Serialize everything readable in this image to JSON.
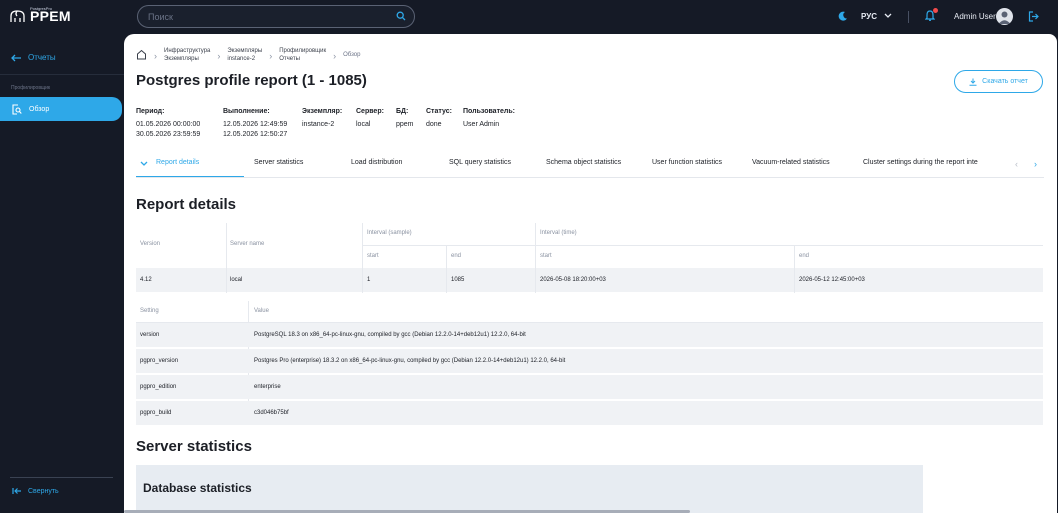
{
  "app": {
    "brand": "PPEM",
    "brand_sub": "PostgresPro",
    "search_placeholder": "Поиск",
    "lang": "РУС",
    "user": "Admin User"
  },
  "sidebar": {
    "back_label": "Отчеты",
    "group_label": "Профилировщик",
    "active_item": "Обзор",
    "collapse_label": "Свернуть"
  },
  "breadcrumbs": [
    {
      "line1": "Инфраструктура",
      "line2": "Экземпляры"
    },
    {
      "line1": "Экземпляры",
      "line2": "instance-2"
    },
    {
      "line1": "Профилировщик",
      "line2": "Отчеты"
    },
    {
      "line1": "Обзор",
      "line2": ""
    }
  ],
  "page": {
    "title": "Postgres profile report (1 - 1085)",
    "download_label": "Скачать отчет"
  },
  "meta": {
    "period": {
      "label": "Период:",
      "line1": "01.05.2026 00:00:00",
      "line2": "30.05.2026 23:59:59"
    },
    "execution": {
      "label": "Выполнение:",
      "line1": "12.05.2026 12:49:59",
      "line2": "12.05.2026 12:50:27"
    },
    "instance": {
      "label": "Экземпляр:",
      "value": "instance-2"
    },
    "server": {
      "label": "Сервер:",
      "value": "local"
    },
    "db": {
      "label": "БД:",
      "value": "ppem"
    },
    "status": {
      "label": "Статус:",
      "value": "done"
    },
    "user": {
      "label": "Пользователь:",
      "value": "User Admin"
    }
  },
  "tabs": [
    "Report details",
    "Server statistics",
    "Load distribution",
    "SQL query statistics",
    "Schema object statistics",
    "User function statistics",
    "Vacuum-related statistics",
    "Cluster settings during the report inte"
  ],
  "report_details": {
    "heading": "Report details",
    "headers": {
      "version": "Version",
      "server_name": "Server name",
      "interval_sample": "Interval (sample)",
      "interval_time": "Interval (time)",
      "start": "start",
      "end": "end"
    },
    "row": {
      "version": "4.12",
      "server_name": "local",
      "sample_start": "1",
      "sample_end": "1085",
      "time_start": "2026-05-08 18:20:00+03",
      "time_end": "2026-05-12 12:45:00+03"
    }
  },
  "settings": {
    "headers": {
      "setting": "Setting",
      "value": "Value"
    },
    "rows": [
      {
        "setting": "version",
        "value": "PostgreSQL 18.3 on x86_64-pc-linux-gnu, compiled by gcc (Debian 12.2.0-14+deb12u1) 12.2.0, 64-bit"
      },
      {
        "setting": "pgpro_version",
        "value": "Postgres Pro (enterprise) 18.3.2 on x86_64-pc-linux-gnu, compiled by gcc (Debian 12.2.0-14+deb12u1) 12.2.0, 64-bit"
      },
      {
        "setting": "pgpro_edition",
        "value": "enterprise"
      },
      {
        "setting": "pgpro_build",
        "value": "c3d046b75bf"
      }
    ]
  },
  "server_statistics": {
    "heading": "Server statistics",
    "sub_heading": "Database statistics"
  },
  "colors": {
    "accent": "#2ea8e8",
    "sidebar_bg": "#151a26",
    "row_bg": "#f0f2f5"
  }
}
